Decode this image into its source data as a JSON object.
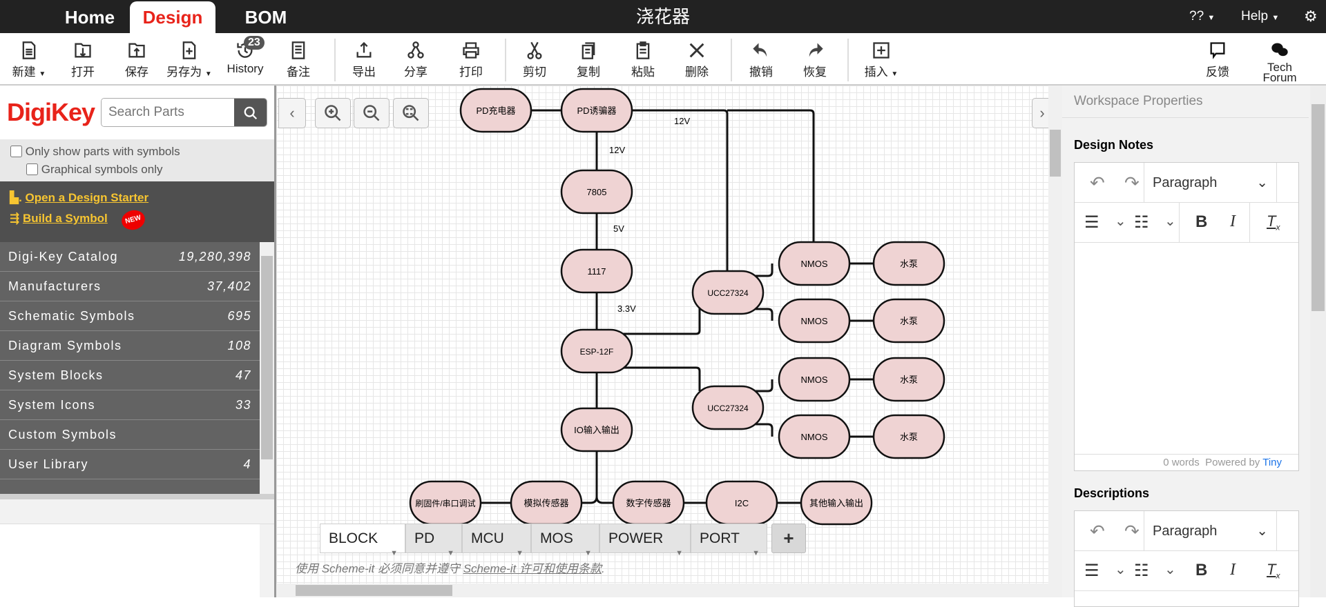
{
  "topbar": {
    "tabs": [
      "Home",
      "Design",
      "BOM"
    ],
    "active": "Design",
    "title": "浇花器",
    "lang": "??",
    "help": "Help",
    "settings_icon": "gear-icon"
  },
  "toolbar": {
    "new": "新建",
    "open": "打开",
    "save": "保存",
    "save_as": "另存为",
    "history": "History",
    "history_count": "23",
    "notes": "备注",
    "export": "导出",
    "share": "分享",
    "print": "打印",
    "cut": "剪切",
    "copy": "复制",
    "paste": "粘贴",
    "delete": "删除",
    "undo": "撤销",
    "redo": "恢复",
    "insert": "插入",
    "feedback": "反馈",
    "tech_forum": "Tech Forum"
  },
  "left": {
    "logo": "DigiKey",
    "search_placeholder": "Search Parts",
    "only_symbols": "Only show parts with symbols",
    "graphical_only": "Graphical symbols only",
    "design_starter": "Open a Design Starter",
    "build_symbol": "Build a Symbol",
    "new_badge": "NEW",
    "categories": [
      {
        "label": "Digi-Key Catalog",
        "count": "19,280,398"
      },
      {
        "label": "Manufacturers",
        "count": "37,402"
      },
      {
        "label": "Schematic Symbols",
        "count": "695"
      },
      {
        "label": "Diagram Symbols",
        "count": "108"
      },
      {
        "label": "System Blocks",
        "count": "47"
      },
      {
        "label": "System Icons",
        "count": "33"
      },
      {
        "label": "Custom Symbols",
        "count": ""
      },
      {
        "label": "User Library",
        "count": "4"
      }
    ]
  },
  "diagram": {
    "node_fill": "#efd3d3",
    "nodes": [
      "PD充电器",
      "PD诱骗器",
      "7805",
      "1117",
      "ESP-12F",
      "IO输入输出",
      "UCC27324",
      "UCC27324",
      "NMOS",
      "NMOS",
      "NMOS",
      "NMOS",
      "水泵",
      "水泵",
      "水泵",
      "水泵",
      "刷固件/串口调试",
      "模拟传感器",
      "数字传感器",
      "I2C",
      "其他输入输出"
    ],
    "edge_labels": [
      "12V",
      "12V",
      "5V",
      "3.3V"
    ]
  },
  "bottom_tabs": [
    "BLOCK",
    "PD",
    "MCU",
    "MOS",
    "POWER",
    "PORT"
  ],
  "add_tab": "+",
  "footer": {
    "prefix": "使用 Scheme-it 必须同意并遵守 ",
    "link": "Scheme-it 许可和使用条款",
    "suffix": "."
  },
  "right": {
    "header": "Workspace Properties",
    "design_notes": "Design Notes",
    "descriptions": "Descriptions",
    "paragraph": "Paragraph",
    "words": "0 words",
    "powered": "Powered by",
    "tiny": "Tiny"
  }
}
